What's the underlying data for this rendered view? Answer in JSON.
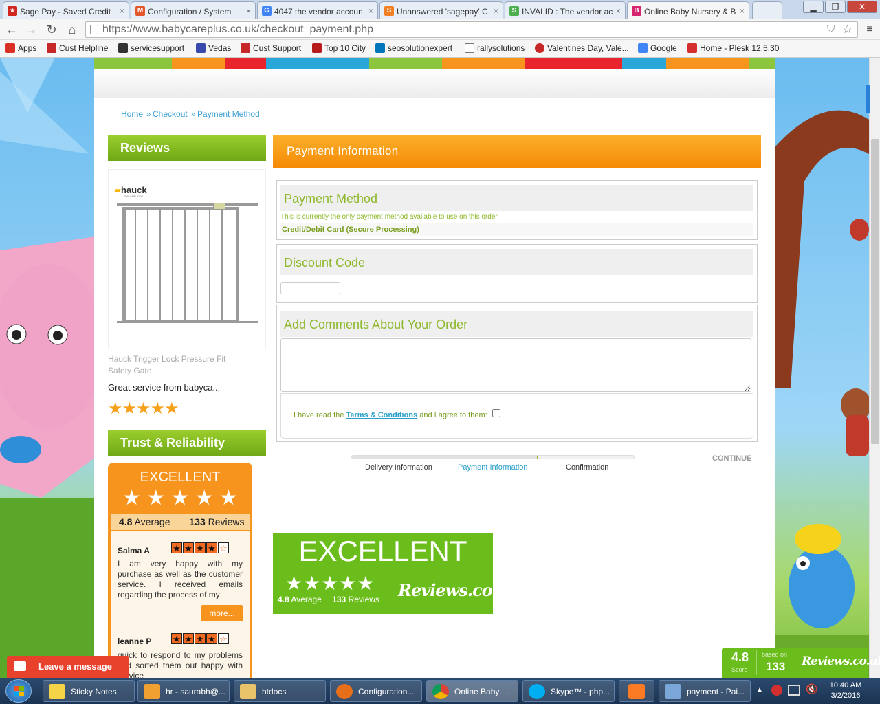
{
  "browser": {
    "tabs": [
      {
        "title": "Sage Pay - Saved Credit",
        "color": "#d1261f",
        "glyph": "★"
      },
      {
        "title": "Configuration / System",
        "color": "#e4572e",
        "glyph": "M"
      },
      {
        "title": "4047 the vendor accoun",
        "color": "#4285f4",
        "glyph": "G"
      },
      {
        "title": "Unanswered 'sagepay' C",
        "color": "#f48024",
        "glyph": "S"
      },
      {
        "title": "INVALID : The vendor ac",
        "color": "#4caf50",
        "glyph": "S"
      },
      {
        "title": "Online Baby Nursery & B",
        "color": "#d6246e",
        "glyph": "B"
      }
    ],
    "url_prefix": "https://www.babycareplus.co.uk",
    "url_path": "/checkout_payment.php",
    "window_buttons": {
      "minimize": "▁",
      "restore": "❐",
      "close": "✕"
    },
    "bookmarks": [
      {
        "label": "Apps",
        "color": "#d93025"
      },
      {
        "label": "Cust Helpline",
        "color": "#c62828"
      },
      {
        "label": "servicesupport",
        "color": "#333333"
      },
      {
        "label": "Vedas",
        "color": "#3949ab"
      },
      {
        "label": "Cust Support",
        "color": "#c62828"
      },
      {
        "label": "Top 10 City",
        "color": "#b71c1c"
      },
      {
        "label": "seosolutionexpert",
        "color": "#0277bd"
      },
      {
        "label": "rallysolutions",
        "color": "#777777"
      },
      {
        "label": "Valentines Day, Vale...",
        "color": "#c62828"
      },
      {
        "label": "Google",
        "color": "#4285f4"
      },
      {
        "label": "Home - Plesk 12.5.30",
        "color": "#d32f2f"
      }
    ]
  },
  "breadcrumb": {
    "home": "Home",
    "sep1": "»",
    "checkout": "Checkout",
    "sep2": "»",
    "current": "Payment Method"
  },
  "sidebar": {
    "reviews_heading": "Reviews",
    "brand": "hauck",
    "brand_sub": "FUN FOR KIDS",
    "product_name_line1": "Hauck Trigger Lock Pressure Fit",
    "product_name_line2": "Safety Gate",
    "review_snippet": "Great service from babyca...",
    "review_rating": 5,
    "trust_heading": "Trust & Reliability",
    "badge": {
      "title": "EXCELLENT",
      "stars": "★ ★ ★ ★ ★",
      "average_value": "4.8",
      "average_label": "Average",
      "reviews_count": "133",
      "reviews_label": "Reviews",
      "review1_name": "Salma A",
      "review1_text": "I am very happy with my purchase as well as the customer service. I received emails regarding the process of my",
      "more_label": "more...",
      "review2_name": "leanne P",
      "review2_text": "quick to respond to my problems and sorted them out happy with service"
    }
  },
  "main": {
    "section_title": "Payment Information",
    "payment_method_title": "Payment Method",
    "payment_note": "This is currently the only payment method available to use on this order.",
    "payment_option": "Credit/Debit Card (Secure Processing)",
    "discount_title": "Discount Code",
    "discount_value": "",
    "comments_title": "Add Comments About Your Order",
    "comments_value": "",
    "terms_prefix": "I have read the",
    "terms_link": "Terms & Conditions",
    "terms_suffix": "and I agree to them:",
    "terms_checked": false,
    "continue_label": "CONTINUE",
    "progress_fraction": 0.66,
    "steps": [
      "Delivery Information",
      "Payment Information",
      "Confirmation"
    ]
  },
  "reviews_badge": {
    "title": "EXCELLENT",
    "stars": "★★★★★",
    "average_value": "4.8",
    "average_label": "Average",
    "count_value": "133",
    "count_label": "Reviews",
    "logo": "Reviews.co.uk"
  },
  "corner_widget": {
    "score": "4.8",
    "score_label": "Score",
    "based_on": "based on",
    "count": "133",
    "logo": "Reviews.co.uk"
  },
  "chat": {
    "label": "Leave a message"
  },
  "taskbar": {
    "items": [
      {
        "label": "Sticky Notes",
        "color": "#f5d547"
      },
      {
        "label": "hr - saurabh@...",
        "color": "#f0a030"
      },
      {
        "label": "htdocs",
        "color": "#e8c36a"
      },
      {
        "label": "Configuration...",
        "color": "#e76f1a"
      },
      {
        "label": "Online Baby ...",
        "color": "#4caf50"
      },
      {
        "label": "Skype™ - php...",
        "color": "#00aff0"
      },
      {
        "label": "",
        "color": "#fb7a24"
      },
      {
        "label": "payment - Pai...",
        "color": "#7aa7d8"
      }
    ],
    "time": "10:40 AM",
    "date": "3/2/2016"
  }
}
